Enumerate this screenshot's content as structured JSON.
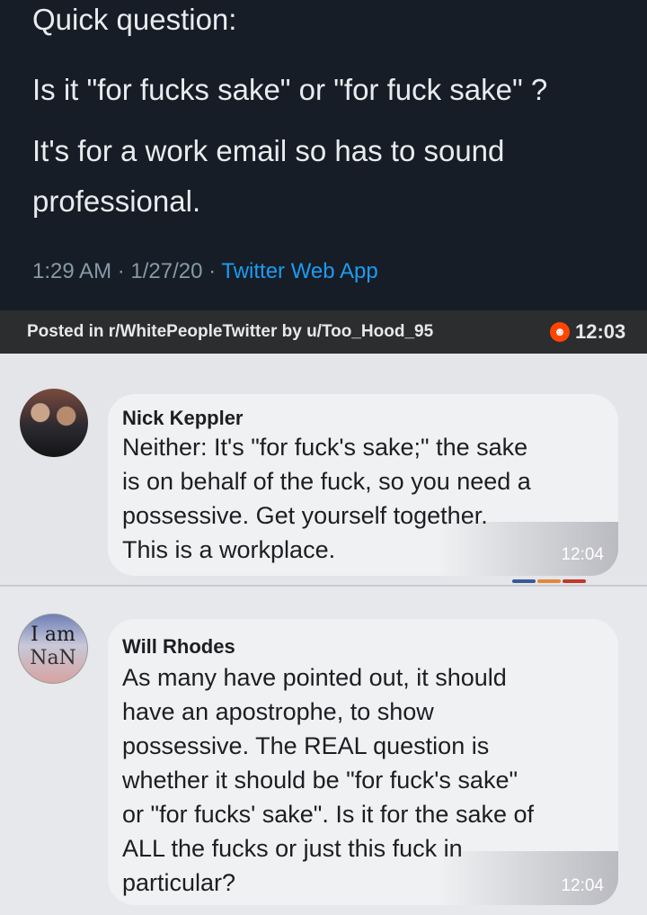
{
  "tweet": {
    "lines": [
      "Quick question:",
      "Is it \"for fucks sake\" or \"for fuck sake\" ?",
      "It's for a work email so has to sound",
      "professional."
    ],
    "meta_prefix": "1:29 AM · 1/27/20 · ",
    "meta_app": "Twitter Web App"
  },
  "reddit_bar": {
    "posted": "Posted in r/WhitePeopleTwitter by u/Too_Hood_95",
    "icon": "reddit-icon",
    "time": "12:03"
  },
  "comments": [
    {
      "name": "Nick Keppler",
      "lines": [
        "Neither: It's \"for fuck's sake;\" the sake",
        "is on behalf of the fuck, so you need a",
        "possessive. Get yourself together.",
        "This is a workplace."
      ],
      "time": "12:04"
    },
    {
      "name": "Will Rhodes",
      "avatar_text": [
        "I am",
        "NaN"
      ],
      "lines": [
        "As many have pointed out, it should",
        "have an apostrophe, to show",
        "possessive. The REAL question is",
        "whether it should be \"for fuck's sake\"",
        "or \"for fucks' sake\". Is it for the sake of",
        "ALL the fucks or just this fuck in",
        "particular?"
      ],
      "time": "12:04"
    }
  ],
  "colors": {
    "tweet_bg": "#161d27",
    "link_blue": "#1d9bf0",
    "reddit_orange": "#ff4500"
  }
}
